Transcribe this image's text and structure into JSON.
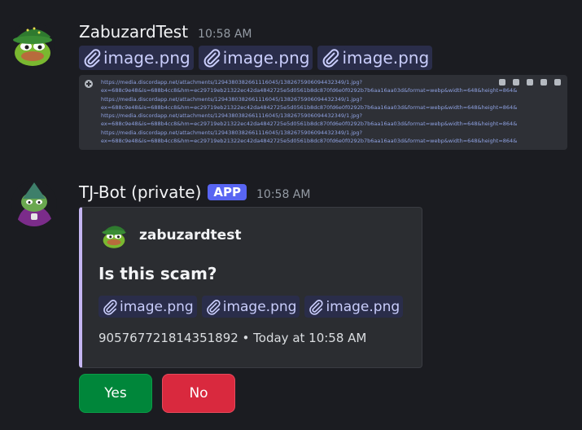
{
  "message1": {
    "username": "ZabuzardTest",
    "timestamp": "10:58 AM",
    "attachments": [
      "image.png",
      "image.png",
      "image.png"
    ],
    "url_lines": [
      "https://media.discordapp.net/attachments/1294380382661116045/1382675906094432349/1.jpg?",
      "ex=688c9e48&is=688b4cc8&hm=ec29719eb21322ec42da4842725e5d0561b8dc870fd6e0f0292b7b6aa16aa03d&format=webp&width=648&height=864&",
      "https://media.discordapp.net/attachments/1294380382661116045/1382675906094432349/1.jpg?",
      "ex=688c9e48&is=688b4cc8&hm=ec29719eb21322ec42da4842725e5d0561b8dc870fd6e0f0292b7b6aa16aa03d&format=webp&width=648&height=864&",
      "https://media.discordapp.net/attachments/1294380382661116045/1382675906094432349/1.jpg?",
      "ex=688c9e48&is=688b4cc8&hm=ec29719eb21322ec42da4842725e5d0561b8dc870fd6e0f0292b7b6aa16aa03d&format=webp&width=648&height=864&",
      "https://media.discordapp.net/attachments/1294380382661116045/1382675906094432349/1.jpg?",
      "ex=688c9e48&is=688b4cc8&hm=ec29719eb21322ec42da4842725e5d0561b8dc870fd6e0f0292b7b6aa16aa03d&format=webp&width=648&height=864&"
    ]
  },
  "message2": {
    "username": "TJ-Bot (private)",
    "badge": "APP",
    "timestamp": "10:58 AM",
    "embed": {
      "author": "zabuzardtest",
      "title": "Is this scam?",
      "attachments": [
        "image.png",
        "image.png",
        "image.png"
      ],
      "footer": "905767721814351892 • Today at 10:58 AM",
      "accent_color": "#c5b6f2"
    },
    "buttons": {
      "yes_label": "Yes",
      "no_label": "No"
    }
  },
  "colors": {
    "background": "#1b1c21",
    "link": "#c9cdfb",
    "yes": "#00863a",
    "no": "#d9293e",
    "app_badge": "#5865f2"
  }
}
